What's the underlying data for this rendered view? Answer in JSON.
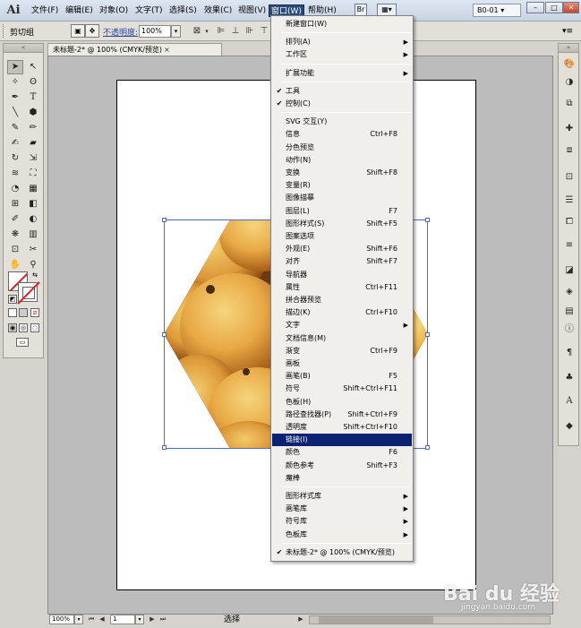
{
  "app": {
    "logo_text": "Ai",
    "menus": [
      "文件(F)",
      "编辑(E)",
      "对象(O)",
      "文字(T)",
      "选择(S)",
      "效果(C)",
      "视图(V)",
      "窗口(W)",
      "帮助(H)"
    ],
    "active_menu_index": 7,
    "workspace": "B0-01"
  },
  "controlbar": {
    "selection_label": "剪切组",
    "opacity_label": "不透明度:",
    "opacity_value": "100%"
  },
  "document": {
    "tab_title": "未标题-2* @ 100% (CMYK/预览)",
    "tab_close": "×"
  },
  "statusbar": {
    "zoom": "100%",
    "page": "1",
    "status_text": "选择"
  },
  "window_menu": {
    "items": [
      {
        "label": "新建窗口(W)",
        "type": "item"
      },
      {
        "type": "sep"
      },
      {
        "label": "排列(A)",
        "type": "submenu"
      },
      {
        "label": "工作区",
        "type": "submenu"
      },
      {
        "type": "sep"
      },
      {
        "label": "扩展功能",
        "type": "submenu"
      },
      {
        "type": "sep"
      },
      {
        "label": "工具",
        "type": "item",
        "checked": true
      },
      {
        "label": "控制(C)",
        "type": "item",
        "checked": true
      },
      {
        "type": "sep"
      },
      {
        "label": "SVG 交互(Y)",
        "type": "item"
      },
      {
        "label": "信息",
        "type": "item",
        "shortcut": "Ctrl+F8"
      },
      {
        "label": "分色预览",
        "type": "item"
      },
      {
        "label": "动作(N)",
        "type": "item"
      },
      {
        "label": "变换",
        "type": "item",
        "shortcut": "Shift+F8"
      },
      {
        "label": "变量(R)",
        "type": "item"
      },
      {
        "label": "图像描摹",
        "type": "item"
      },
      {
        "label": "图层(L)",
        "type": "item",
        "shortcut": "F7"
      },
      {
        "label": "图形样式(S)",
        "type": "item",
        "shortcut": "Shift+F5"
      },
      {
        "label": "图案选项",
        "type": "item"
      },
      {
        "label": "外观(E)",
        "type": "item",
        "shortcut": "Shift+F6"
      },
      {
        "label": "对齐",
        "type": "item",
        "shortcut": "Shift+F7"
      },
      {
        "label": "导航器",
        "type": "item"
      },
      {
        "label": "属性",
        "type": "item",
        "shortcut": "Ctrl+F11"
      },
      {
        "label": "拼合器预览",
        "type": "item"
      },
      {
        "label": "描边(K)",
        "type": "item",
        "shortcut": "Ctrl+F10"
      },
      {
        "label": "文字",
        "type": "submenu"
      },
      {
        "label": "文档信息(M)",
        "type": "item"
      },
      {
        "label": "渐变",
        "type": "item",
        "shortcut": "Ctrl+F9"
      },
      {
        "label": "画板",
        "type": "item"
      },
      {
        "label": "画笔(B)",
        "type": "item",
        "shortcut": "F5"
      },
      {
        "label": "符号",
        "type": "item",
        "shortcut": "Shift+Ctrl+F11"
      },
      {
        "label": "色板(H)",
        "type": "item"
      },
      {
        "label": "路径查找器(P)",
        "type": "item",
        "shortcut": "Shift+Ctrl+F9"
      },
      {
        "label": "透明度",
        "type": "item",
        "shortcut": "Shift+Ctrl+F10"
      },
      {
        "label": "链接(I)",
        "type": "item",
        "highlighted": true
      },
      {
        "label": "颜色",
        "type": "item",
        "shortcut": "F6"
      },
      {
        "label": "颜色参考",
        "type": "item",
        "shortcut": "Shift+F3"
      },
      {
        "label": "魔棒",
        "type": "item"
      },
      {
        "type": "sep"
      },
      {
        "label": "图形样式库",
        "type": "submenu"
      },
      {
        "label": "画笔库",
        "type": "submenu"
      },
      {
        "label": "符号库",
        "type": "submenu"
      },
      {
        "label": "色板库",
        "type": "submenu"
      },
      {
        "type": "sep"
      },
      {
        "label": "未标题-2* @ 100% (CMYK/预览)",
        "type": "item",
        "checked": true
      }
    ]
  },
  "watermark": {
    "logo": "Bai du 经验",
    "url": "jingyan.baidu.com"
  },
  "colors": {
    "menu_highlight": "#0c2373",
    "selection_blue": "#4a6bd6",
    "fruit_orange": "#e8a844"
  }
}
